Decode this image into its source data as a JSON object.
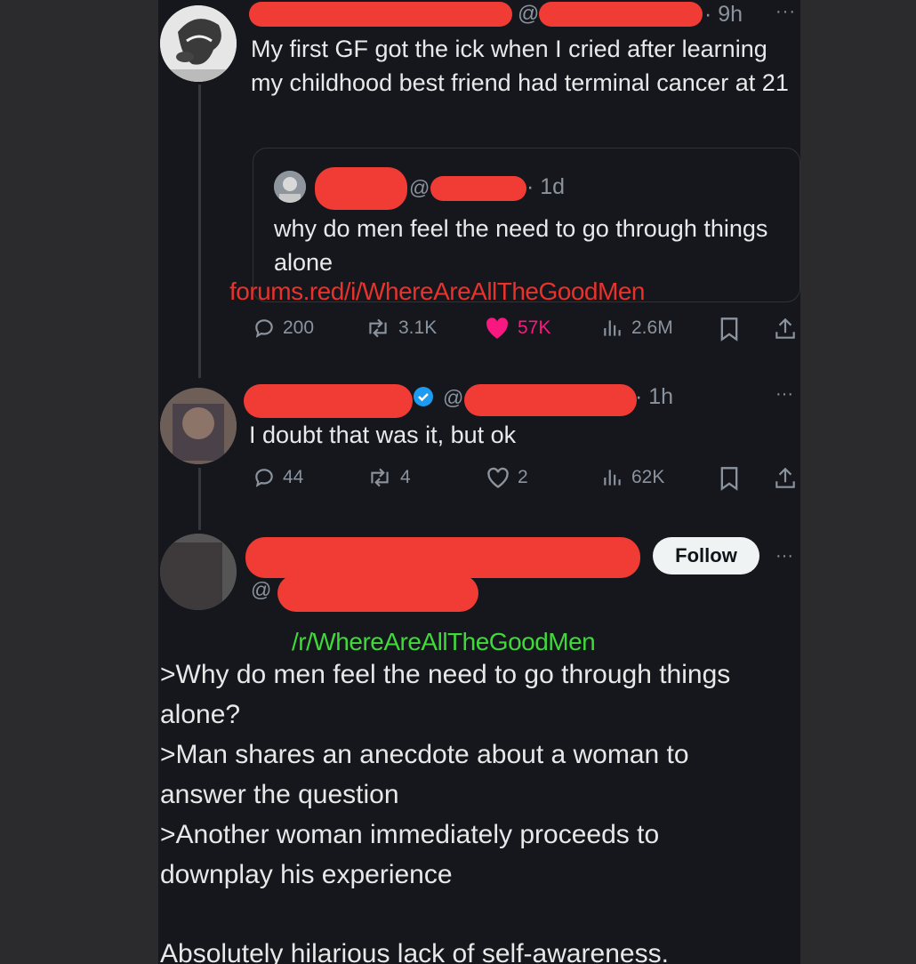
{
  "tweet1": {
    "handle_prefix": "@",
    "time": "· 9h",
    "more": "···",
    "text": "My first GF got the ick when I cried after learning my childhood best friend had terminal cancer at 21"
  },
  "quoted": {
    "handle_prefix": "@",
    "time": "· 1d",
    "text": "why do men feel the need to go through things alone"
  },
  "watermark_red": "forums.red/i/WhereAreAllTheGoodMen",
  "tweet1_actions": {
    "replies": "200",
    "reposts": "3.1K",
    "likes": "57K",
    "views": "2.6M"
  },
  "tweet2": {
    "handle_prefix": "@",
    "time": "· 1h",
    "more": "···",
    "text": "I doubt that was it, but ok"
  },
  "tweet2_actions": {
    "replies": "44",
    "reposts": "4",
    "likes": "2",
    "views": "62K"
  },
  "profile": {
    "handle_prefix": "@",
    "follow_label": "Follow",
    "more": "···"
  },
  "watermark_green": "/r/WhereAreAllTheGoodMen",
  "comment": {
    "line1": ">Why do men feel the need to go through things alone?",
    "line2": ">Man shares an anecdote about a woman to answer the question",
    "line3": ">Another woman immediately proceeds to downplay his experience",
    "line4": "Absolutely hilarious lack of self-awareness."
  },
  "colors": {
    "background": "#15171c",
    "redaction": "#f03c35",
    "like_pink": "#f91880",
    "verified_blue": "#1d9bf0",
    "watermark_red": "#e8322c",
    "watermark_green": "#3fd93a"
  },
  "icons": [
    "reply-icon",
    "repost-icon",
    "heart-icon",
    "views-icon",
    "bookmark-icon",
    "share-icon",
    "verified-badge-icon",
    "more-icon"
  ]
}
